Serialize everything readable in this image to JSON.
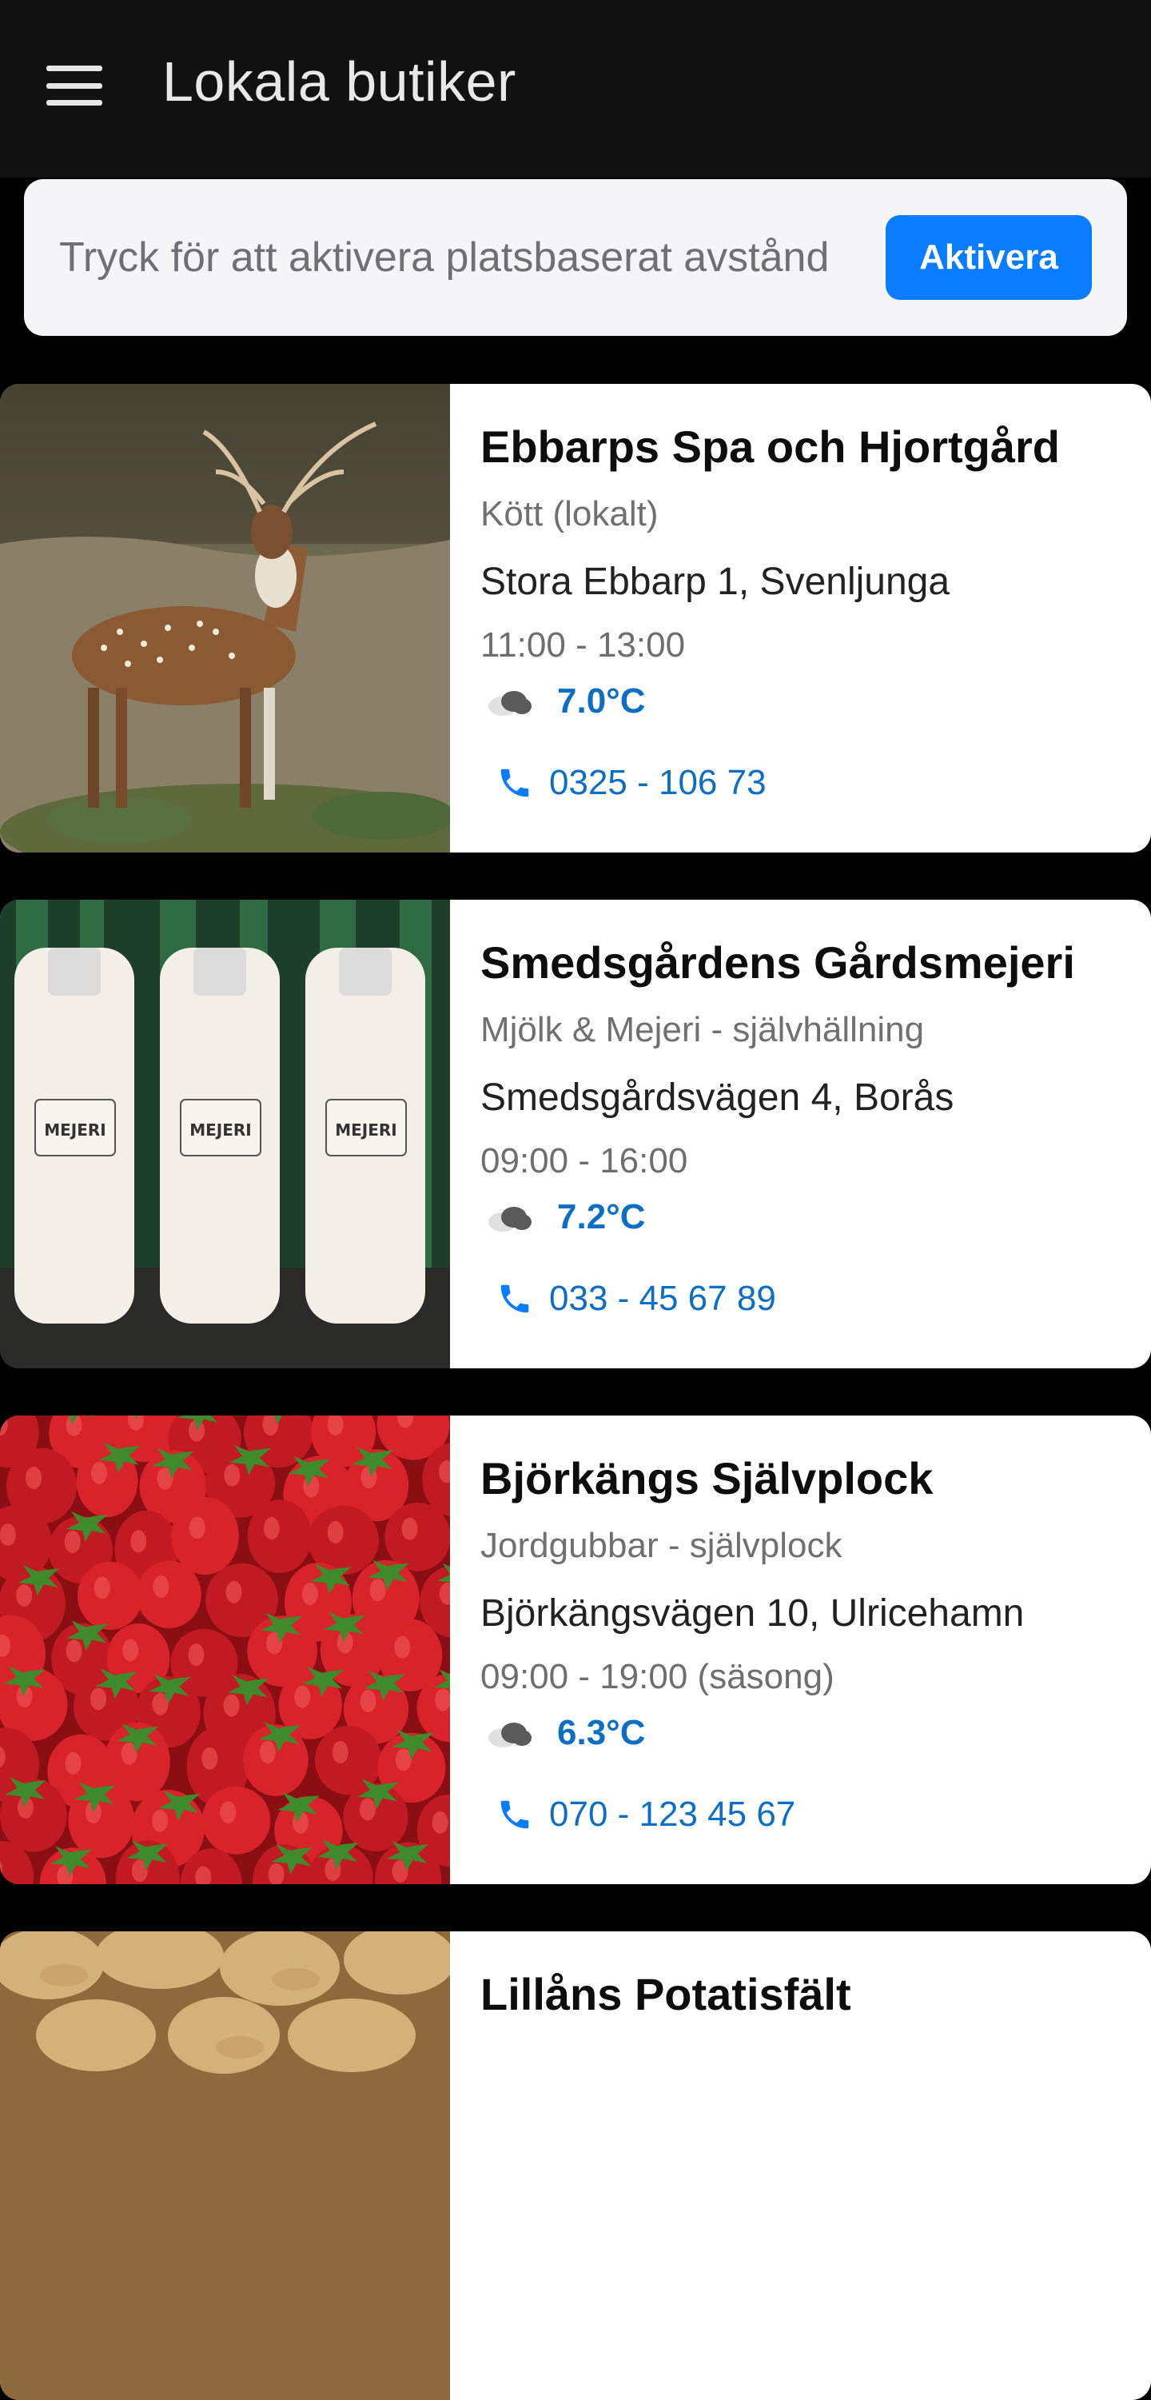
{
  "appbar": {
    "title": "Lokala butiker",
    "menu_icon": "menu-icon"
  },
  "location_banner": {
    "text": "Tryck för att aktivera platsbaserat avstånd",
    "button_label": "Aktivera"
  },
  "colors": {
    "accent": "#0a7cff",
    "link": "#0d6fc4",
    "appbar": "#121212"
  },
  "shops": [
    {
      "name": "Ebbarps Spa och Hjortgård",
      "category": "Kött (lokalt)",
      "address": "Stora Ebbarp 1, Svenljunga",
      "hours": "11:00 - 13:00",
      "temperature": "7.0°C",
      "phone": "0325 - 106 73",
      "image": "deer-photo"
    },
    {
      "name": "Smedsgårdens Gårdsmejeri",
      "category": "Mjölk & Mejeri - självhällning",
      "address": "Smedsgårdsvägen 4, Borås",
      "hours": "09:00 - 16:00",
      "temperature": "7.2°C",
      "phone": "033 - 45 67 89",
      "image": "milk-bottles-photo",
      "bottle_label": "MEJERI"
    },
    {
      "name": "Björkängs Självplock",
      "category": "Jordgubbar - självplock",
      "address": "Björkängsvägen 10, Ulricehamn",
      "hours": "09:00 - 19:00 (säsong)",
      "temperature": "6.3°C",
      "phone": "070 - 123 45 67",
      "image": "strawberries-photo"
    },
    {
      "name": "Lillåns Potatisfält",
      "image": "potatoes-photo"
    }
  ]
}
